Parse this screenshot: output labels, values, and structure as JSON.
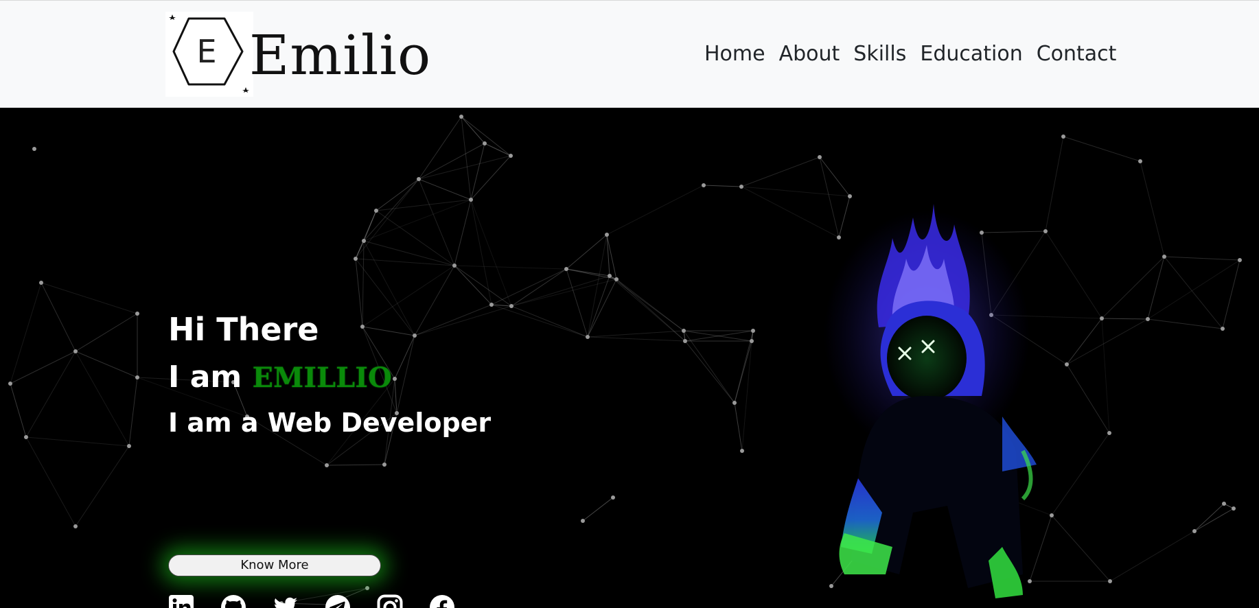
{
  "header": {
    "logo_letter": "E",
    "logo_text": "Emilio",
    "nav": [
      {
        "label": "Home"
      },
      {
        "label": "About"
      },
      {
        "label": "Skills"
      },
      {
        "label": "Education"
      },
      {
        "label": "Contact"
      }
    ]
  },
  "hero": {
    "greeting": "Hi There",
    "iam_prefix": "I am ",
    "name": "EMILLIO",
    "role": "I am a Web Developer",
    "cta_label": "Know More",
    "socials": [
      {
        "icon": "linkedin-icon"
      },
      {
        "icon": "github-icon"
      },
      {
        "icon": "twitter-icon"
      },
      {
        "icon": "telegram-icon"
      },
      {
        "icon": "instagram-icon"
      },
      {
        "icon": "facebook-icon"
      }
    ]
  },
  "colors": {
    "name_green": "#0a8a0a",
    "glow_green": "#1ed21e",
    "background": "#000000",
    "navbar_bg": "#f8f9fa"
  }
}
